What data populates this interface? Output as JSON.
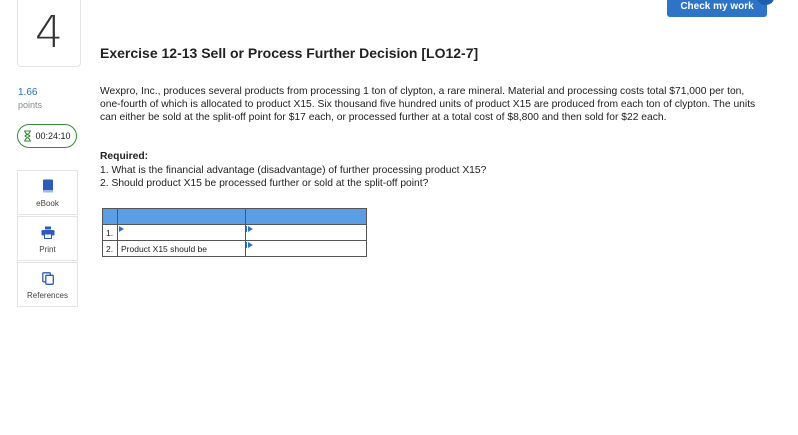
{
  "question_number": "4",
  "points": {
    "value": "1.66",
    "label": "points"
  },
  "timer": {
    "value": "00:24:10"
  },
  "sidebar": {
    "items": [
      {
        "label": "eBook",
        "icon": "book-icon"
      },
      {
        "label": "Print",
        "icon": "printer-icon"
      },
      {
        "label": "References",
        "icon": "copy-icon"
      }
    ]
  },
  "header": {
    "check_my_work": "Check my work"
  },
  "exercise": {
    "title": "Exercise 12-13 Sell or Process Further Decision [LO12-7]",
    "problem": "Wexpro, Inc., produces several products from processing 1 ton of clypton, a rare mineral. Material and processing costs total $71,000 per ton, one-fourth of which is allocated to product X15. Six thousand five hundred units of product X15 are produced from each ton of clypton. The units can either be sold at the split-off point for $17 each, or processed further at a total cost of $8,800 and then sold for $22 each.",
    "required_label": "Required:",
    "questions": [
      "1. What is the financial advantage (disadvantage) of further processing product X15?",
      "2. Should product X15 be processed further or sold at the split-off point?"
    ]
  },
  "answer_table": {
    "rows": [
      {
        "num": "1.",
        "label": "",
        "answer": ""
      },
      {
        "num": "2.",
        "label": "Product X15 should be",
        "answer": ""
      }
    ]
  },
  "colors": {
    "accent": "#2d73c6",
    "table_header": "#5b9ee6",
    "timer_border": "#3a8a3a"
  }
}
